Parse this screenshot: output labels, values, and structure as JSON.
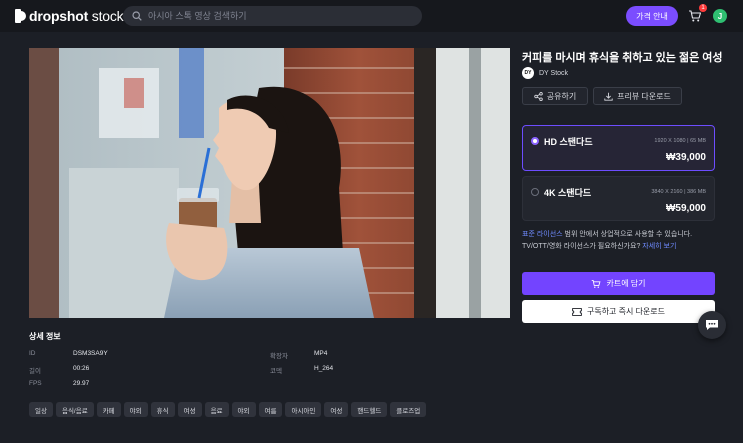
{
  "header": {
    "logo_bold": "dropshot",
    "logo_thin": "stock",
    "search_placeholder": "아시아 스톡 영상 검색하기",
    "pricing_label": "가격 안내",
    "cart_count": "1",
    "avatar_initial": "J"
  },
  "product": {
    "title": "커피를 마시며 휴식을 취하고 있는 젊은 여성",
    "author_logo": "DY",
    "author": "DY Stock",
    "share_label": "공유하기",
    "preview_download_label": "프리뷰 다운로드"
  },
  "options": [
    {
      "name": "HD 스탠다드",
      "spec": "1920 X 1080 | 65 MB",
      "price": "₩39,000",
      "selected": true
    },
    {
      "name": "4K 스탠다드",
      "spec": "3840 X 2160 | 386 MB",
      "price": "₩59,000",
      "selected": false
    }
  ],
  "notice": {
    "link1": "표준 라이선스",
    "text1": " 범위 안에서 상업적으로 사용할 수 있습니다.",
    "text2": "TV/OTT/영화 라이선스가 필요하신가요? ",
    "link2": "자세히 보기"
  },
  "actions": {
    "add_to_cart": "카트에 담기",
    "subscribe_download": "구독하고 즉시 다운로드"
  },
  "details": {
    "title": "상세 정보",
    "left": [
      {
        "label": "ID",
        "value": "DSM3SA9Y"
      },
      {
        "label": "길이",
        "value": "00:26"
      },
      {
        "label": "FPS",
        "value": "29.97"
      }
    ],
    "right": [
      {
        "label": "확장자",
        "value": "MP4"
      },
      {
        "label": "코덱",
        "value": "H_264"
      }
    ]
  },
  "tags": [
    "일상",
    "음식/음료",
    "카페",
    "야외",
    "휴식",
    "여성",
    "음료",
    "야외",
    "여름",
    "아시아인",
    "여성",
    "핸드헬드",
    "클로즈업"
  ],
  "colors": {
    "accent": "#7344ff",
    "background": "#1c1f26"
  }
}
